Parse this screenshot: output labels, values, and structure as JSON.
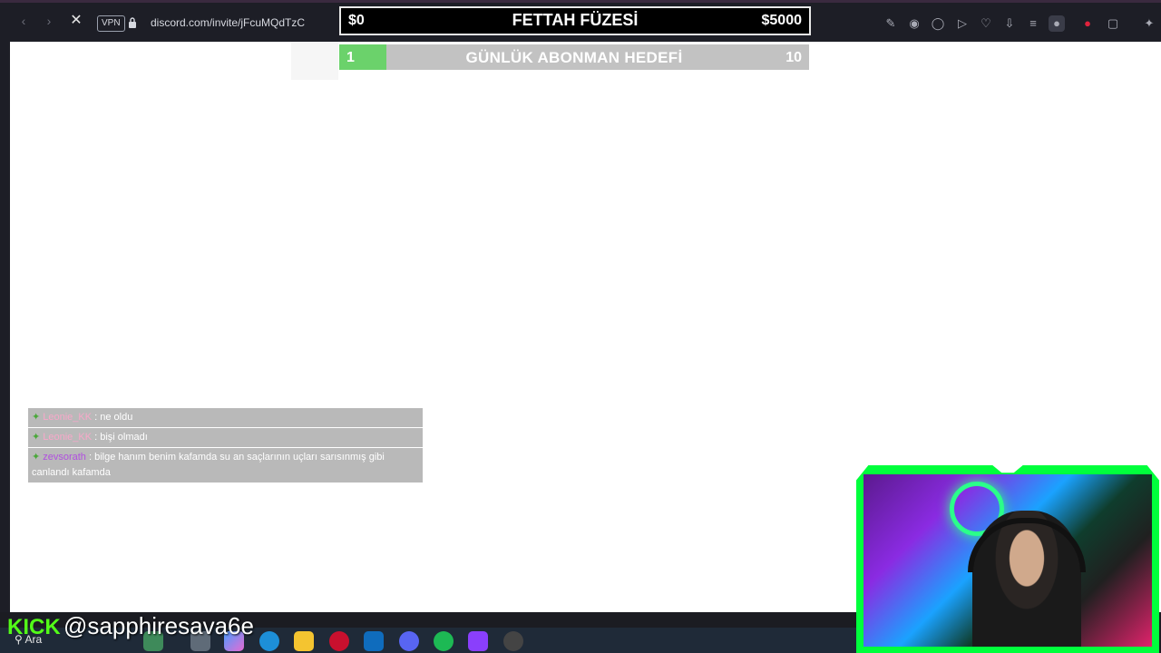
{
  "browser": {
    "vpn_label": "VPN",
    "url": "discord.com/invite/jFcuMQdTzC"
  },
  "overlay_goal_top": {
    "left_value": "$0",
    "title": "FETTAH FÜZESİ",
    "right_value": "$5000"
  },
  "overlay_goal_sub": {
    "left_value": "1",
    "title": "GÜNLÜK ABONMAN HEDEFİ",
    "right_value": "10",
    "progress_fraction": 0.1,
    "fill_color": "#6bd26b"
  },
  "chat": [
    {
      "user": "Leonie_KK",
      "text": ": ne oldu"
    },
    {
      "user": "Leonie_KK",
      "text": ": bişi olmadı"
    },
    {
      "user": "zevsorath",
      "text": ": bilge hanım benim kafamda su an saçlarının uçları sarısınmış gibi canlandı kafamda"
    }
  ],
  "watermark": {
    "brand": "KICK",
    "handle": "@sapphiresava6e"
  },
  "taskbar": {
    "search_label": "Ara"
  },
  "colors": {
    "kick_green": "#53fc18",
    "cam_frame": "#00ff3c"
  }
}
